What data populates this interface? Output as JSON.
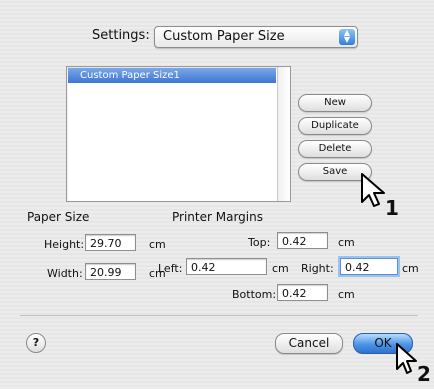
{
  "settings": {
    "label": "Settings:",
    "value": "Custom Paper Size"
  },
  "list": {
    "items": [
      "Custom Paper Size1"
    ],
    "selected_index": 0
  },
  "buttons": {
    "new": "New",
    "duplicate": "Duplicate",
    "delete": "Delete",
    "save": "Save"
  },
  "paper_size": {
    "heading": "Paper Size",
    "height_label": "Height:",
    "height_value": "29.70",
    "height_unit": "cm",
    "width_label": "Width:",
    "width_value": "20.99",
    "width_unit": "cm"
  },
  "margins": {
    "heading": "Printer Margins",
    "top_label": "Top:",
    "top_value": "0.42",
    "top_unit": "cm",
    "left_label": "Left:",
    "left_value": "0.42",
    "left_unit": "cm",
    "right_label": "Right:",
    "right_value": "0.42",
    "right_unit": "cm",
    "bottom_label": "Bottom:",
    "bottom_value": "0.42",
    "bottom_unit": "cm"
  },
  "footer": {
    "help": "?",
    "cancel": "Cancel",
    "ok": "OK"
  },
  "callouts": {
    "step1": "1",
    "step2": "2"
  },
  "icons": {
    "popup": "popup-arrows-icon",
    "cursor": "pointer-cursor-icon",
    "help": "help-icon"
  },
  "colors": {
    "selection": "#3d75d2",
    "default_button": "#4b94e5"
  }
}
